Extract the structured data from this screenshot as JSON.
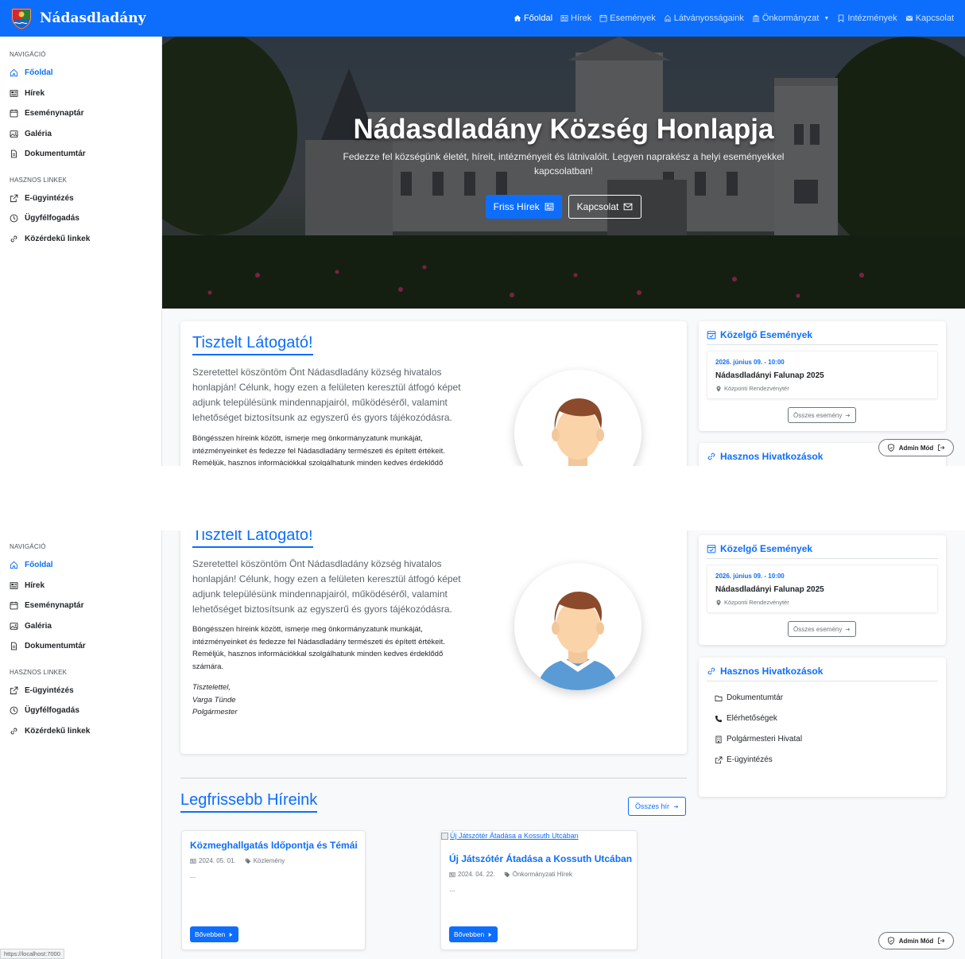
{
  "navbar": {
    "brand": "Nádasdladány",
    "links": [
      {
        "label": "Főoldal",
        "icon": "home-icon",
        "active": true
      },
      {
        "label": "Hírek",
        "icon": "newspaper-icon"
      },
      {
        "label": "Események",
        "icon": "calendar-icon"
      },
      {
        "label": "Látványosságaink",
        "icon": "landmark-icon"
      },
      {
        "label": "Önkormányzat",
        "icon": "bank-icon",
        "dropdown": true
      },
      {
        "label": "Intézmények",
        "icon": "building-icon"
      },
      {
        "label": "Kapcsolat",
        "icon": "envelope-icon"
      }
    ]
  },
  "sidebar": {
    "nav_heading": "NAVIGÁCIÓ",
    "nav_items": [
      {
        "label": "Főoldal",
        "icon": "home-icon",
        "active": true
      },
      {
        "label": "Hírek",
        "icon": "newspaper-icon"
      },
      {
        "label": "Eseménynaptár",
        "icon": "calendar-icon"
      },
      {
        "label": "Galéria",
        "icon": "image-icon"
      },
      {
        "label": "Dokumentumtár",
        "icon": "document-icon"
      }
    ],
    "links_heading": "HASZNOS LINKEK",
    "link_items": [
      {
        "label": "E-ügyintézés",
        "icon": "external-link-icon"
      },
      {
        "label": "Ügyfélfogadás",
        "icon": "clock-icon"
      },
      {
        "label": "Közérdekű linkek",
        "icon": "link-icon"
      }
    ]
  },
  "hero": {
    "title": "Nádasdladány Község Honlapja",
    "subtitle": "Fedezze fel községünk életét, híreit, intézményeit és látnivalóit. Legyen naprakész a helyi eseményekkel kapcsolatban!",
    "primary_label": "Friss Hírek",
    "secondary_label": "Kapcsolat"
  },
  "welcome": {
    "title": "Tisztelt Látogató!",
    "lead": "Szeretettel köszöntöm Önt Nádasdladány község hivatalos honlapján! Célunk, hogy ezen a felületen keresztül átfogó képet adjunk településünk mindennapjairól, működéséről, valamint lehetőséget biztosítsunk az egyszerű és gyors tájékozódásra.",
    "body": "Böngésszen híreink között, ismerje meg önkormányzatunk munkáját, intézményeinket és fedezze fel Nádasdladány természeti és épített értékeit. Reméljük, hasznos információkkal szolgálhatunk minden kedves érdeklődő számára.",
    "sign_1": "Tisztelettel,",
    "sign_2": "Varga Tünde",
    "sign_3": "Polgármester"
  },
  "events": {
    "title": "Közelgő Események",
    "item": {
      "date": "2026. június 09. - 10:00",
      "name": "Nádasdladányi Falunap 2025",
      "location": "Központi Rendezvénytér"
    },
    "all_label": "Összes esemény"
  },
  "links": {
    "title": "Hasznos Hivatkozások",
    "items": [
      {
        "label": "Dokumentumtár",
        "icon": "folder-icon"
      },
      {
        "label": "Elérhetőségek",
        "icon": "phone-icon"
      },
      {
        "label": "Polgármesteri Hivatal",
        "icon": "building-icon"
      },
      {
        "label": "E-ügyintézés",
        "icon": "external-link-icon"
      }
    ]
  },
  "admin": {
    "label": "Admin Mód"
  },
  "news": {
    "title": "Legfrissebb Híreink",
    "all_label": "Összes hír",
    "items": [
      {
        "title": "Közmeghallgatás Időpontja és Témái",
        "date": "2024. 05. 01.",
        "category": "Közlemény",
        "excerpt": "...",
        "more": "Bővebben"
      },
      {
        "image_alt": "Új Játszótér Átadása a Kossuth Utcában",
        "title": "Új Játszótér Átadása a Kossuth Utcában",
        "date": "2024. 04. 22.",
        "category": "Önkormányzati Hírek",
        "excerpt": "...",
        "more": "Bővebben"
      }
    ]
  },
  "status_url": "https://localhost:7000",
  "colors": {
    "primary": "#0d6efd",
    "sidebar_bg": "#ffffff",
    "page_bg": "#f8f9fa"
  }
}
